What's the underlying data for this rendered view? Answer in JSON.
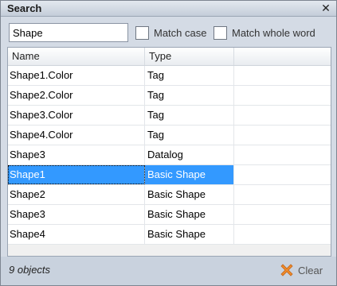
{
  "window": {
    "title": "Search",
    "close_glyph": "✕"
  },
  "search": {
    "value": "Shape",
    "placeholder": ""
  },
  "options": {
    "match_case": "Match case",
    "match_whole_word": "Match whole word"
  },
  "grid": {
    "columns": [
      "Name",
      "Type"
    ],
    "rows": [
      {
        "name": "Shape1.Color",
        "type": "Tag"
      },
      {
        "name": "Shape2.Color",
        "type": "Tag"
      },
      {
        "name": "Shape3.Color",
        "type": "Tag"
      },
      {
        "name": "Shape4.Color",
        "type": "Tag"
      },
      {
        "name": "Shape3",
        "type": "Datalog"
      },
      {
        "name": "Shape1",
        "type": "Basic Shape",
        "selected": true
      },
      {
        "name": "Shape2",
        "type": "Basic Shape"
      },
      {
        "name": "Shape3",
        "type": "Basic Shape"
      },
      {
        "name": "Shape4",
        "type": "Basic Shape"
      }
    ]
  },
  "status": {
    "count": "9 objects",
    "clear_label": "Clear",
    "clear_icon": "x-icon"
  },
  "colors": {
    "selection": "#3399ff",
    "clear_icon": "#f08a2a"
  }
}
